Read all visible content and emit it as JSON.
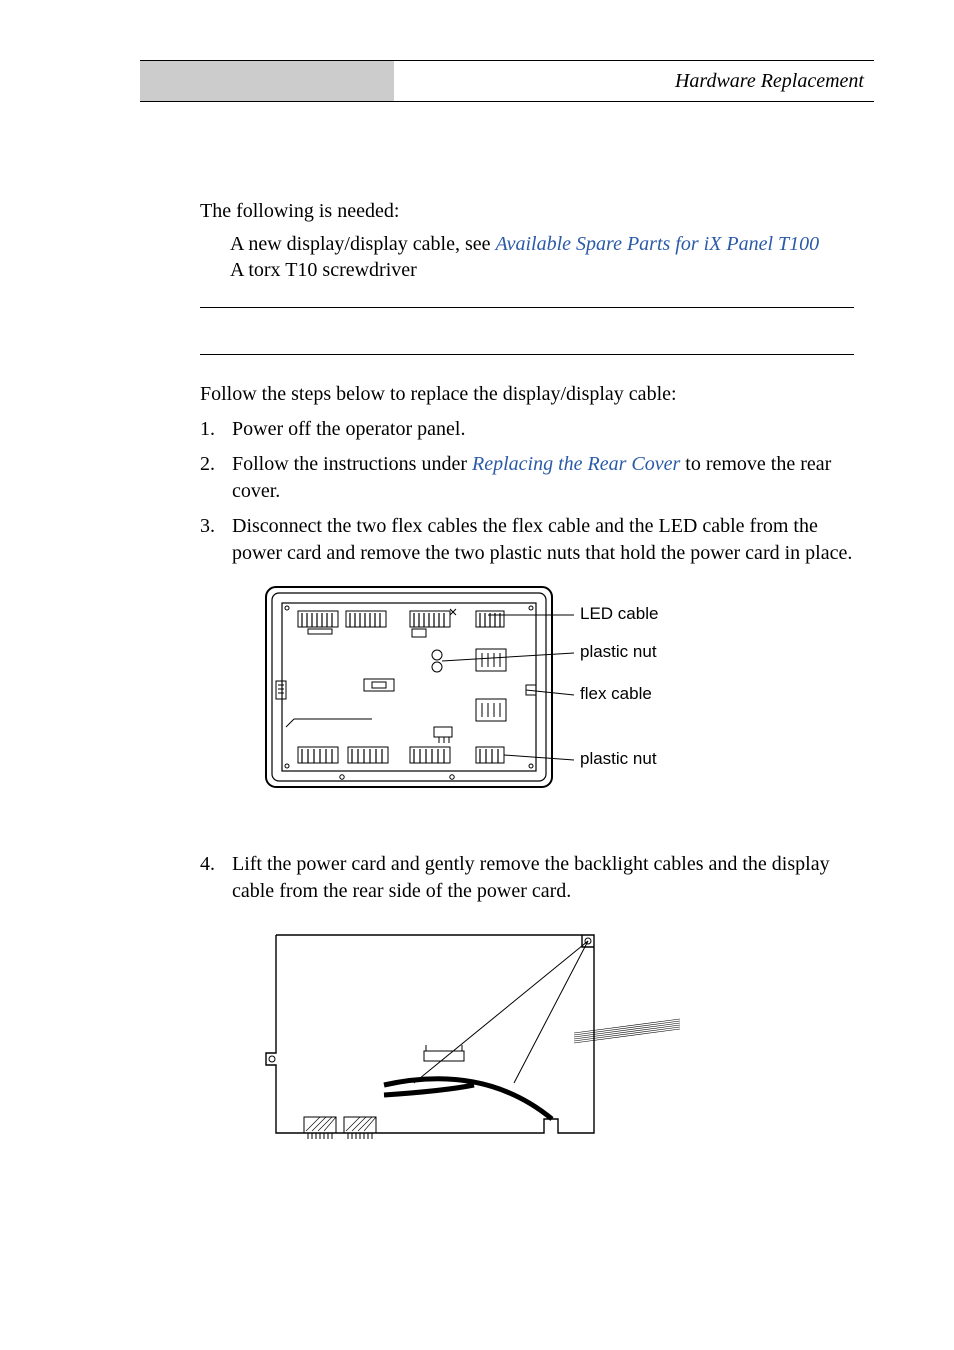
{
  "header": {
    "title": "Hardware Replacement"
  },
  "intro": "The following is needed:",
  "bullets": {
    "b1_pre": "A new display/display cable, see ",
    "b1_link": "Available Spare Parts for iX Panel T100",
    "b2": "A torx T10 screwdriver"
  },
  "steps_intro": "Follow the steps below to replace the display/display cable:",
  "steps": {
    "s1": {
      "n": "1.",
      "text": "Power off the operator panel."
    },
    "s2": {
      "n": "2.",
      "pre": "Follow the instructions under ",
      "link": "Replacing the Rear Cover",
      "post": " to remove the rear cover."
    },
    "s3": {
      "n": "3.",
      "text": "Disconnect the two flex cables the flex cable and the LED cable from the power card and remove the two plastic nuts that hold the power card in place."
    },
    "s4": {
      "n": "4.",
      "text": "Lift the power card and gently remove the backlight cables and the display cable from the rear side of the power card."
    }
  },
  "fig1_labels": {
    "led": "LED cable",
    "pn1": "plastic nut",
    "flex": "flex cable",
    "pn2": "plastic nut"
  }
}
